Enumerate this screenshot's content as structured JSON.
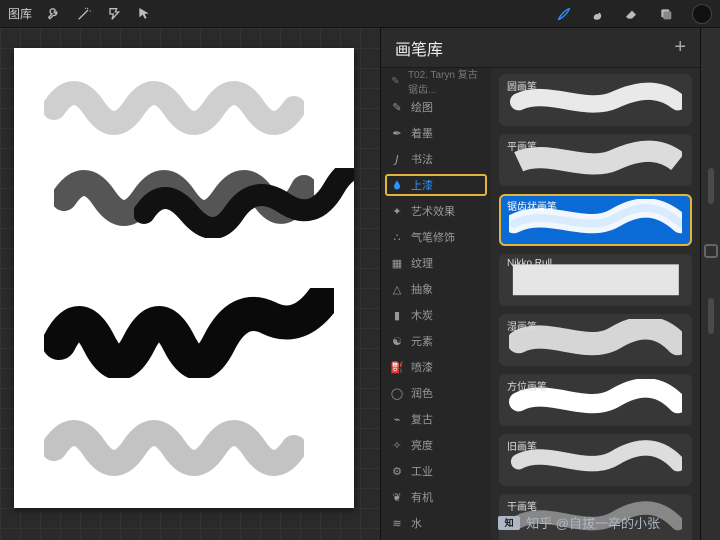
{
  "topbar": {
    "gallery_label": "图库"
  },
  "panel": {
    "title": "画笔库"
  },
  "recent": {
    "label": "T02. Taryn 复古锯齿..."
  },
  "categories": [
    {
      "id": "sketch",
      "label": "绘图"
    },
    {
      "id": "ink",
      "label": "着墨"
    },
    {
      "id": "calli",
      "label": "书法"
    },
    {
      "id": "paint",
      "label": "上漆",
      "selected": true
    },
    {
      "id": "artistic",
      "label": "艺术效果"
    },
    {
      "id": "airbrush",
      "label": "气笔修饰"
    },
    {
      "id": "texture",
      "label": "纹理"
    },
    {
      "id": "abstract",
      "label": "抽象"
    },
    {
      "id": "charcoal",
      "label": "木炭"
    },
    {
      "id": "elements",
      "label": "元素"
    },
    {
      "id": "spray",
      "label": "喷漆"
    },
    {
      "id": "touchup",
      "label": "润色"
    },
    {
      "id": "retro",
      "label": "复古"
    },
    {
      "id": "lumi",
      "label": "亮度"
    },
    {
      "id": "indust",
      "label": "工业"
    },
    {
      "id": "organic",
      "label": "有机"
    },
    {
      "id": "water",
      "label": "水"
    }
  ],
  "brushes": [
    {
      "id": "round",
      "label": "圆画笔"
    },
    {
      "id": "flat",
      "label": "平画笔"
    },
    {
      "id": "jag",
      "label": "锯齿状画笔",
      "selected": true
    },
    {
      "id": "nikko",
      "label": "Nikko Rull"
    },
    {
      "id": "wet",
      "label": "湿画笔"
    },
    {
      "id": "orient",
      "label": "方位画笔"
    },
    {
      "id": "old",
      "label": "旧画笔"
    },
    {
      "id": "dry",
      "label": "干画笔"
    }
  ],
  "watermark": {
    "text": "知乎 @自拔一卒的小张"
  },
  "colors": {
    "accent": "#2a93ff",
    "highlight": "#e2b43a"
  }
}
